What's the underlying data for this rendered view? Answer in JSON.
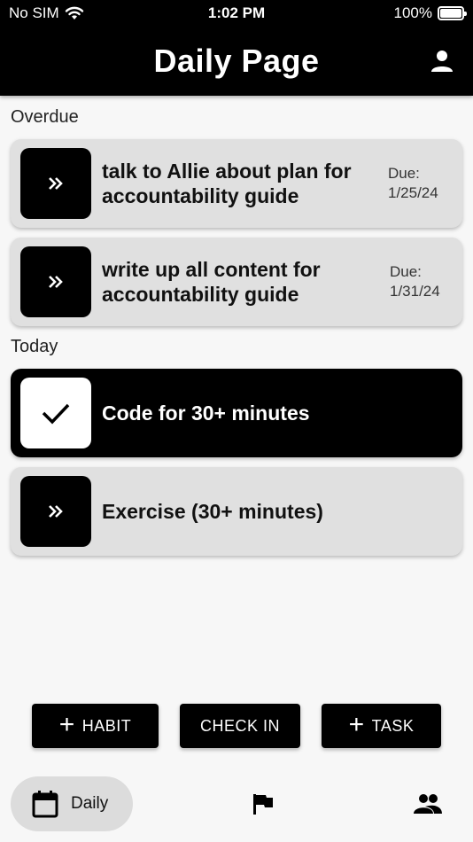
{
  "status_bar": {
    "carrier": "No SIM",
    "time": "1:02 PM",
    "battery": "100%"
  },
  "header": {
    "title": "Daily Page"
  },
  "sections": {
    "overdue_label": "Overdue",
    "today_label": "Today"
  },
  "overdue_tasks": [
    {
      "text": "talk to Allie about plan for accountability guide",
      "due_label": "Due:",
      "due_date": "1/25/24"
    },
    {
      "text": "write up all content for accountability guide",
      "due_label": "Due:",
      "due_date": "1/31/24"
    }
  ],
  "today_tasks": [
    {
      "text": "Code for 30+ minutes",
      "completed": true
    },
    {
      "text": "Exercise (30+ minutes)",
      "completed": false
    }
  ],
  "actions": {
    "habit_label": "HABIT",
    "checkin_label": "CHECK IN",
    "task_label": "TASK"
  },
  "nav": {
    "daily_label": "Daily"
  },
  "colors": {
    "primary": "#000000",
    "card": "#e0e0e0",
    "background": "#f7f7f7",
    "nav_active": "#dcdcdc"
  }
}
